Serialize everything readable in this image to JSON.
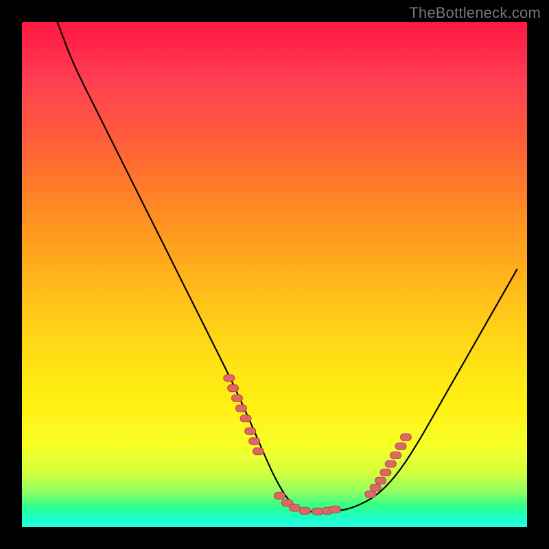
{
  "watermark": "TheBottleneck.com",
  "colors": {
    "page_bg": "#000000",
    "curve": "#000000",
    "marker_fill": "#e06666",
    "marker_stroke": "#b04a4a"
  },
  "chart_data": {
    "type": "line",
    "title": "",
    "xlabel": "",
    "ylabel": "",
    "xlim": [
      0,
      100
    ],
    "ylim": [
      0,
      100
    ],
    "grid": false,
    "legend": false,
    "series": [
      {
        "name": "curve",
        "x": [
          7,
          10,
          14,
          18,
          22,
          26,
          30,
          34,
          38,
          42,
          46,
          49,
          51,
          53,
          55,
          57,
          60,
          63,
          66,
          70,
          74,
          78,
          82,
          86,
          90,
          94,
          98
        ],
        "y": [
          100,
          92,
          84,
          76,
          68,
          60,
          52,
          44,
          36,
          28,
          19,
          12,
          8,
          5,
          3.5,
          3,
          3,
          3.2,
          4,
          6,
          10,
          16,
          23,
          30,
          37,
          44,
          51
        ]
      }
    ],
    "markers": [
      {
        "name": "left-cluster",
        "x": [
          41.0,
          41.8,
          42.6,
          43.4,
          44.3,
          45.2,
          46.0,
          46.8
        ],
        "y": [
          29.5,
          27.5,
          25.5,
          23.5,
          21.5,
          19.0,
          17.0,
          15.0
        ]
      },
      {
        "name": "valley-cluster",
        "x": [
          51.0,
          52.5,
          54.0,
          56.0,
          58.5,
          60.5,
          62.0
        ],
        "y": [
          6.2,
          4.8,
          3.8,
          3.2,
          3.1,
          3.2,
          3.5
        ]
      },
      {
        "name": "right-cluster",
        "x": [
          69.0,
          70.0,
          71.0,
          72.0,
          73.0,
          74.0,
          75.0,
          76.0
        ],
        "y": [
          6.5,
          7.8,
          9.2,
          10.8,
          12.5,
          14.2,
          16.0,
          17.8
        ]
      }
    ],
    "bands_y": [
      78,
      80.5,
      83,
      85.5
    ]
  }
}
